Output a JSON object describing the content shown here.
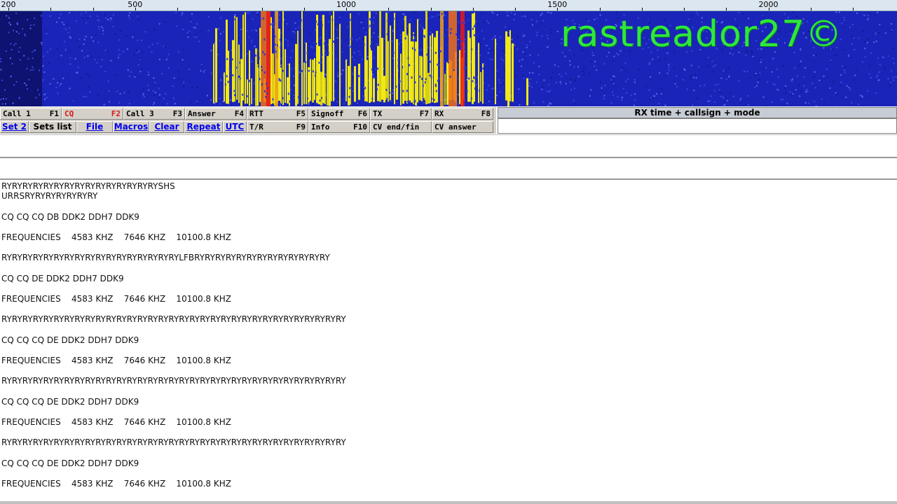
{
  "ruler": {
    "ticks": [
      {
        "label": "200",
        "freq": 200
      },
      {
        "label": "500",
        "freq": 500
      },
      {
        "label": "1000",
        "freq": 1000
      },
      {
        "label": "1500",
        "freq": 1500
      },
      {
        "label": "2000",
        "freq": 2000
      }
    ]
  },
  "waterfall": {
    "watermark": "rastreador27©",
    "background": "#1a24b8"
  },
  "macros": {
    "row1": [
      {
        "label": "Call 1",
        "fkey": "F1",
        "color": "#000000"
      },
      {
        "label": "CQ",
        "fkey": "F2",
        "color": "#d81818"
      },
      {
        "label": "Call 3",
        "fkey": "F3",
        "color": "#000000"
      },
      {
        "label": "Answer",
        "fkey": "F4",
        "color": "#000000"
      },
      {
        "label": "RTT",
        "fkey": "F5",
        "color": "#000000"
      },
      {
        "label": "Signoff",
        "fkey": "F6",
        "color": "#000000"
      },
      {
        "label": "TX",
        "fkey": "F7",
        "color": "#000000"
      },
      {
        "label": "RX",
        "fkey": "F8",
        "color": "#000000"
      }
    ],
    "row2": [
      {
        "label": "Set 2"
      },
      {
        "label": "Sets list"
      },
      {
        "label": "File"
      },
      {
        "label": "Macros"
      },
      {
        "label": "Clear"
      },
      {
        "label": "Repeat"
      },
      {
        "label": "UTC"
      }
    ],
    "row2b": [
      {
        "label": "T/R",
        "fkey": "F9"
      },
      {
        "label": "Info",
        "fkey": "F10"
      },
      {
        "label": "CV end/fin",
        "fkey": ""
      },
      {
        "label": "CV answer",
        "fkey": ""
      }
    ]
  },
  "rx_panel": {
    "header": "RX time + callsign + mode"
  },
  "rx_text": {
    "lines": [
      "RYRYRYRYRYRYRYRYRYRYRYRYRYRYRYSHS",
      "URRSRYRYRYRYRYRYRY",
      "CQ CQ CQ DB DDK2 DDH7 DDK9",
      "FREQUENCIES    4583 KHZ    7646 KHZ    10100.8 KHZ",
      "RYRYRYRYRYRYRYRYRYRYRYRYRYRYRYRYRYLFBRYRYRYRYRYRYRYRYRYRYRYRYRY",
      "CQ CQ DE DDK2 DDH7 DDK9",
      "FREQUENCIES    4583 KHZ    7646 KHZ    10100.8 KHZ",
      "RYRYRYRYRYRYRYRYRYRYRYRYRYRYRYRYRYRYRYRYRYRYRYRYRYRYRYRYRYRYRYRYRY",
      "CQ CQ CQ DE DDK2 DDH7 DDK9",
      "FREQUENCIES    4583 KHZ    7646 KHZ    10100.8 KHZ",
      "RYRYRYRYRYRYRYRYRYRYRYRYRYRYRYRYRYRYRYRYRYRYRYRYRYRYRYRYRYRYRYRYRY",
      "CQ CQ CQ DE DDK2 DDH7 DDK9",
      "FREQUENCIES    4583 KHZ    7646 KHZ    10100.8 KHZ",
      "RYRYRYRYRYRYRYRYRYRYRYRYRYRYRYRYRYRYRYRYRYRYRYRYRYRYRYRYRYRYRYRYRY",
      "CQ CQ CQ DE DDK2 DDH7 DDK9",
      "FREQUENCIES    4583 KHZ    7646 KHZ    10100.8 KHZ"
    ]
  }
}
